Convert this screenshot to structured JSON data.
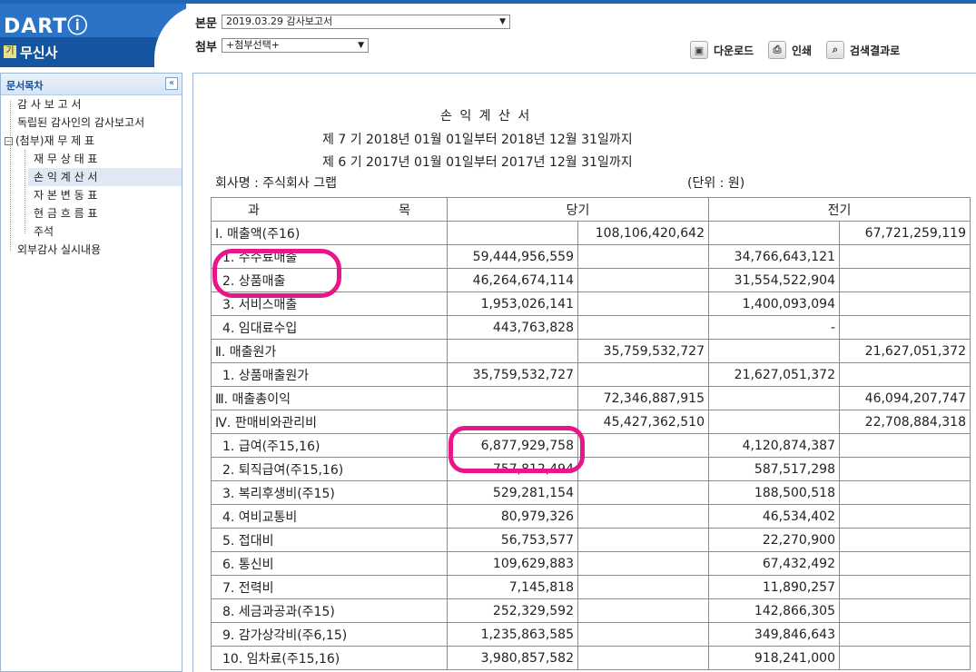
{
  "header": {
    "logo": "DARTⓘ",
    "company_badge": "기",
    "company_name": "무신사",
    "main_doc_label": "본문",
    "main_doc_value": "2019.03.29 감사보고서",
    "attach_label": "첨부",
    "attach_value": "+첨부선택+",
    "toolbar": {
      "download": "다운로드",
      "print": "인쇄",
      "search_results": "검색결과로"
    }
  },
  "sidebar": {
    "title": "문서목차",
    "collapse_icon": "«",
    "items": [
      {
        "label": "감 사 보 고 서"
      },
      {
        "label": "독립된 감사인의 감사보고서"
      },
      {
        "label": "(첨부)재 무 제 표"
      },
      {
        "label": "재 무 상 태 표"
      },
      {
        "label": "손 익 계 산 서"
      },
      {
        "label": "자 본 변 동 표"
      },
      {
        "label": "현 금 흐 름 표"
      },
      {
        "label": "주석"
      },
      {
        "label": "외부감사 실시내용"
      }
    ]
  },
  "document": {
    "title": "손 익 계 산 서",
    "period_current": "제 7 기 2018년 01월 01일부터 2018년 12월 31일까지",
    "period_prior": "제 6 기 2017년 01월 01일부터 2017년 12월 31일까지",
    "company": "회사명 : 주식회사 그랩",
    "unit": "(단위 : 원)",
    "headers": {
      "account": "과 목",
      "current": "당기",
      "prior": "전기"
    },
    "rows": [
      {
        "label": "Ⅰ. 매출액(주16)",
        "c1": "",
        "c2": "108,106,420,642",
        "p1": "",
        "p2": "67,721,259,119"
      },
      {
        "label": "1. 수수료매출",
        "c1": "59,444,956,559",
        "c2": "",
        "p1": "34,766,643,121",
        "p2": ""
      },
      {
        "label": "2. 상품매출",
        "c1": "46,264,674,114",
        "c2": "",
        "p1": "31,554,522,904",
        "p2": ""
      },
      {
        "label": "3. 서비스매출",
        "c1": "1,953,026,141",
        "c2": "",
        "p1": "1,400,093,094",
        "p2": ""
      },
      {
        "label": "4. 임대료수입",
        "c1": "443,763,828",
        "c2": "",
        "p1": "-",
        "p2": ""
      },
      {
        "label": "Ⅱ. 매출원가",
        "c1": "",
        "c2": "35,759,532,727",
        "p1": "",
        "p2": "21,627,051,372"
      },
      {
        "label": "1. 상품매출원가",
        "c1": "35,759,532,727",
        "c2": "",
        "p1": "21,627,051,372",
        "p2": ""
      },
      {
        "label": "Ⅲ. 매출총이익",
        "c1": "",
        "c2": "72,346,887,915",
        "p1": "",
        "p2": "46,094,207,747"
      },
      {
        "label": "Ⅳ. 판매비와관리비",
        "c1": "",
        "c2": "45,427,362,510",
        "p1": "",
        "p2": "22,708,884,318"
      },
      {
        "label": "1. 급여(주15,16)",
        "c1": "6,877,929,758",
        "c2": "",
        "p1": "4,120,874,387",
        "p2": ""
      },
      {
        "label": "2. 퇴직급여(주15,16)",
        "c1": "757,812,494",
        "c2": "",
        "p1": "587,517,298",
        "p2": ""
      },
      {
        "label": "3. 복리후생비(주15)",
        "c1": "529,281,154",
        "c2": "",
        "p1": "188,500,518",
        "p2": ""
      },
      {
        "label": "4. 여비교통비",
        "c1": "80,979,326",
        "c2": "",
        "p1": "46,534,402",
        "p2": ""
      },
      {
        "label": "5. 접대비",
        "c1": "56,753,577",
        "c2": "",
        "p1": "22,270,900",
        "p2": ""
      },
      {
        "label": "6. 통신비",
        "c1": "109,629,883",
        "c2": "",
        "p1": "67,432,492",
        "p2": ""
      },
      {
        "label": "7. 전력비",
        "c1": "7,145,818",
        "c2": "",
        "p1": "11,890,257",
        "p2": ""
      },
      {
        "label": "8. 세금과공과(주15)",
        "c1": "252,329,592",
        "c2": "",
        "p1": "142,866,305",
        "p2": ""
      },
      {
        "label": "9. 감가상각비(주6,15)",
        "c1": "1,235,863,585",
        "c2": "",
        "p1": "349,846,643",
        "p2": ""
      },
      {
        "label": "10. 임차료(주15,16)",
        "c1": "3,980,857,582",
        "c2": "",
        "p1": "918,241,000",
        "p2": ""
      }
    ]
  },
  "colors": {
    "highlight": "#e8168a",
    "brand": "#2a73c6"
  }
}
